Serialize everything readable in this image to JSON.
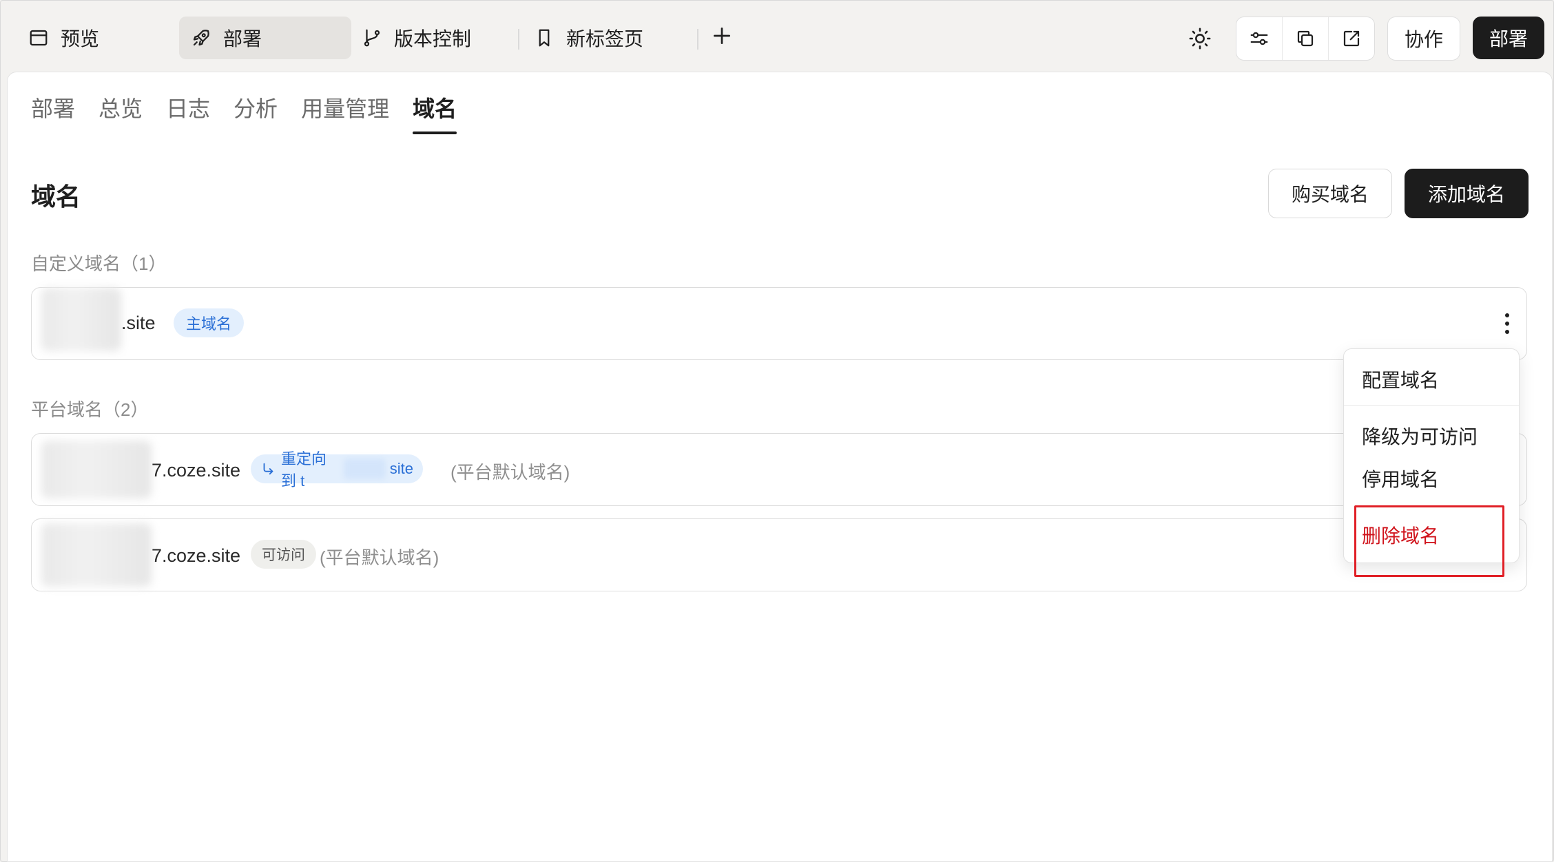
{
  "topbar": {
    "tabs": [
      {
        "label": "预览",
        "icon": "browser-window-icon",
        "active": false
      },
      {
        "label": "部署",
        "icon": "rocket-icon",
        "active": true
      },
      {
        "label": "版本控制",
        "icon": "git-branch-icon",
        "active": false
      },
      {
        "label": "新标签页",
        "icon": "bookmark-icon",
        "active": false
      }
    ],
    "add_tab_icon": "plus-icon",
    "theme_icon": "sun-icon",
    "tool_icons": [
      "sliders-icon",
      "copy-icon",
      "external-link-icon"
    ],
    "collab_label": "协作",
    "deploy_label": "部署"
  },
  "subtabs": [
    "部署",
    "总览",
    "日志",
    "分析",
    "用量管理",
    "域名"
  ],
  "active_subtab": "域名",
  "page": {
    "title": "域名",
    "buy_label": "购买域名",
    "add_label": "添加域名"
  },
  "custom_domains": {
    "label": "自定义域名（1）",
    "items": [
      {
        "domain_suffix": ".site",
        "badge": "主域名"
      }
    ]
  },
  "platform_domains": {
    "label": "平台域名（2）",
    "items": [
      {
        "domain_suffix": "7.coze.site",
        "redirect_prefix": "重定向到 t",
        "redirect_suffix": "site",
        "note": "(平台默认域名)"
      },
      {
        "domain_suffix": "7.coze.site",
        "badge": "可访问",
        "note": "(平台默认域名)"
      }
    ]
  },
  "menu": {
    "items": [
      "配置域名",
      "降级为可访问",
      "停用域名",
      "删除域名"
    ],
    "danger_color": "#d0141c"
  },
  "colors": {
    "primary_dark": "#1c1c1c",
    "accent_blue": "#2a6fd6",
    "highlight_red": "#e01f26"
  }
}
